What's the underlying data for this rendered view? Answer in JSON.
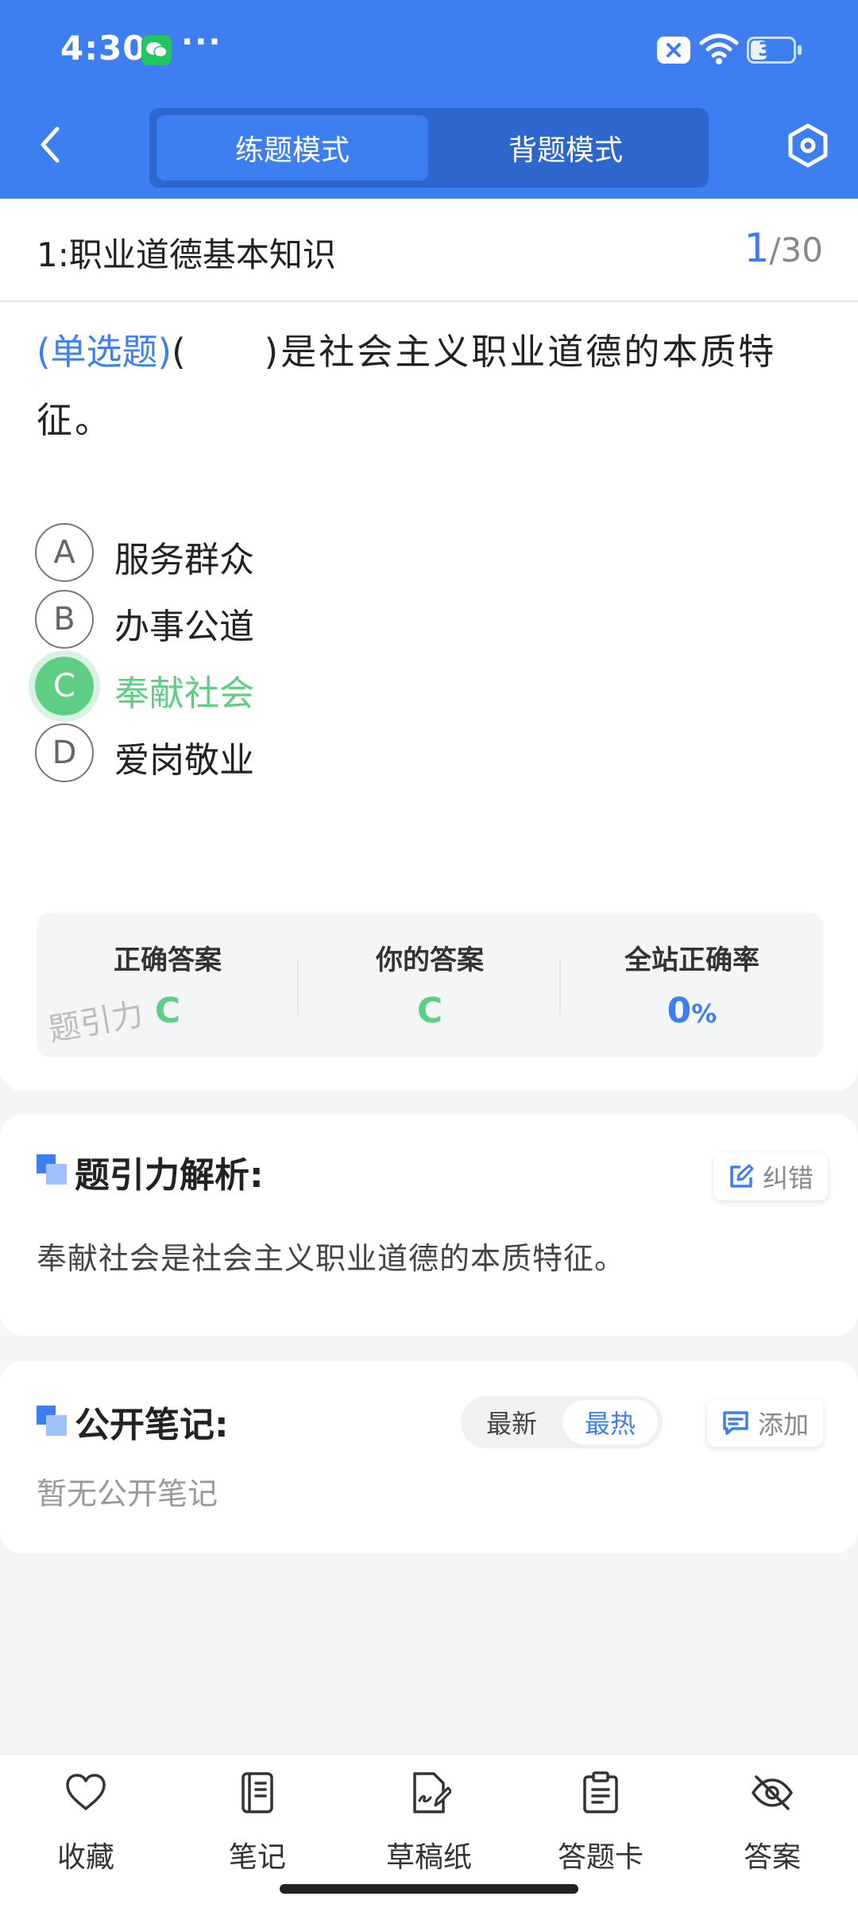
{
  "status_bar": {
    "time": "4:30",
    "dots": "···",
    "battery": "34"
  },
  "header": {
    "modes": [
      "练题模式",
      "背题模式"
    ],
    "active_mode": "练题模式"
  },
  "question": {
    "chapter": "1:职业道德基本知识",
    "current": "1",
    "total": "/30",
    "type_tag": "(单选题)",
    "blank": "(　　)",
    "text": "是社会主义职业道德的本质特征。",
    "options": [
      {
        "letter": "A",
        "text": "服务群众"
      },
      {
        "letter": "B",
        "text": "办事公道"
      },
      {
        "letter": "C",
        "text": "奉献社会"
      },
      {
        "letter": "D",
        "text": "爱岗敬业"
      }
    ],
    "selected": "C"
  },
  "result": {
    "correct_label": "正确答案",
    "correct_value": "C",
    "yours_label": "你的答案",
    "yours_value": "C",
    "rate_label": "全站正确率",
    "rate_value": "0",
    "rate_unit": "%",
    "watermark": "题引力"
  },
  "analysis": {
    "title": "题引力解析:",
    "fix_label": "纠错",
    "text": "奉献社会是社会主义职业道德的本质特征。"
  },
  "notes": {
    "title": "公开笔记:",
    "sort_latest": "最新",
    "sort_hot": "最热",
    "add_label": "添加",
    "empty": "暂无公开笔记"
  },
  "bottom_nav": [
    {
      "label": "收藏",
      "icon": "heart-icon"
    },
    {
      "label": "笔记",
      "icon": "notebook-icon"
    },
    {
      "label": "草稿纸",
      "icon": "draft-pen-icon"
    },
    {
      "label": "答题卡",
      "icon": "clipboard-icon"
    },
    {
      "label": "答案",
      "icon": "eye-off-icon"
    }
  ],
  "colors": {
    "brand": "#3d7ff0",
    "correct": "#5fce85"
  }
}
